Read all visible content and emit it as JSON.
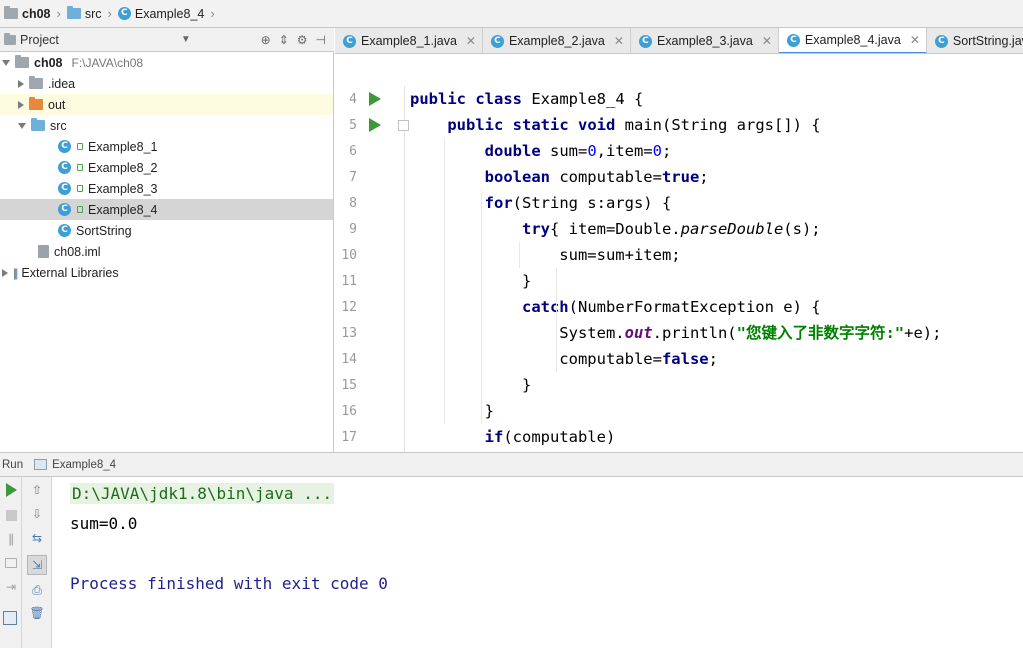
{
  "breadcrumb": {
    "items": [
      "ch08",
      "src",
      "Example8_4"
    ]
  },
  "project_panel": {
    "title": "Project",
    "tree": [
      {
        "label": "ch08",
        "hint": "F:\\JAVA\\ch08"
      },
      {
        "label": ".idea"
      },
      {
        "label": "out"
      },
      {
        "label": "src"
      },
      {
        "label": "Example8_1"
      },
      {
        "label": "Example8_2"
      },
      {
        "label": "Example8_3"
      },
      {
        "label": "Example8_4"
      },
      {
        "label": "SortString"
      },
      {
        "label": "ch08.iml"
      },
      {
        "label": "External Libraries"
      }
    ]
  },
  "tabs": [
    {
      "label": "Example8_1.java"
    },
    {
      "label": "Example8_2.java"
    },
    {
      "label": "Example8_3.java"
    },
    {
      "label": "Example8_4.java"
    },
    {
      "label": "SortString.java"
    }
  ],
  "active_tab": "Example8_4.java",
  "editor": {
    "lines": [
      {
        "n": "4",
        "t": "public class Example8_4 {"
      },
      {
        "n": "5",
        "t": "    public static void main(String args[]) {"
      },
      {
        "n": "6",
        "t": "        double sum=0,item=0;"
      },
      {
        "n": "7",
        "t": "        boolean computable=true;"
      },
      {
        "n": "8",
        "t": "        for(String s:args) {"
      },
      {
        "n": "9",
        "t": "            try{ item=Double.parseDouble(s);"
      },
      {
        "n": "10",
        "t": "                sum=sum+item;"
      },
      {
        "n": "11",
        "t": "            }"
      },
      {
        "n": "12",
        "t": "            catch(NumberFormatException e) {"
      },
      {
        "n": "13",
        "t": "                System.out.println(\"您键入了非数字字符:\"+e);"
      },
      {
        "n": "14",
        "t": "                computable=false;"
      },
      {
        "n": "15",
        "t": "            }"
      },
      {
        "n": "16",
        "t": "        }"
      },
      {
        "n": "17",
        "t": "        if(computable)"
      }
    ]
  },
  "run_panel": {
    "label": "Run",
    "config": "Example8_4",
    "console": [
      "D:\\JAVA\\jdk1.8\\bin\\java ...",
      "sum=0.0",
      "",
      "Process finished with exit code 0"
    ]
  },
  "colors": {
    "keyword": "#000080",
    "string": "#008000",
    "number": "#0000ff",
    "run_green": "#3a9a3a",
    "accent": "#4a90d9"
  }
}
